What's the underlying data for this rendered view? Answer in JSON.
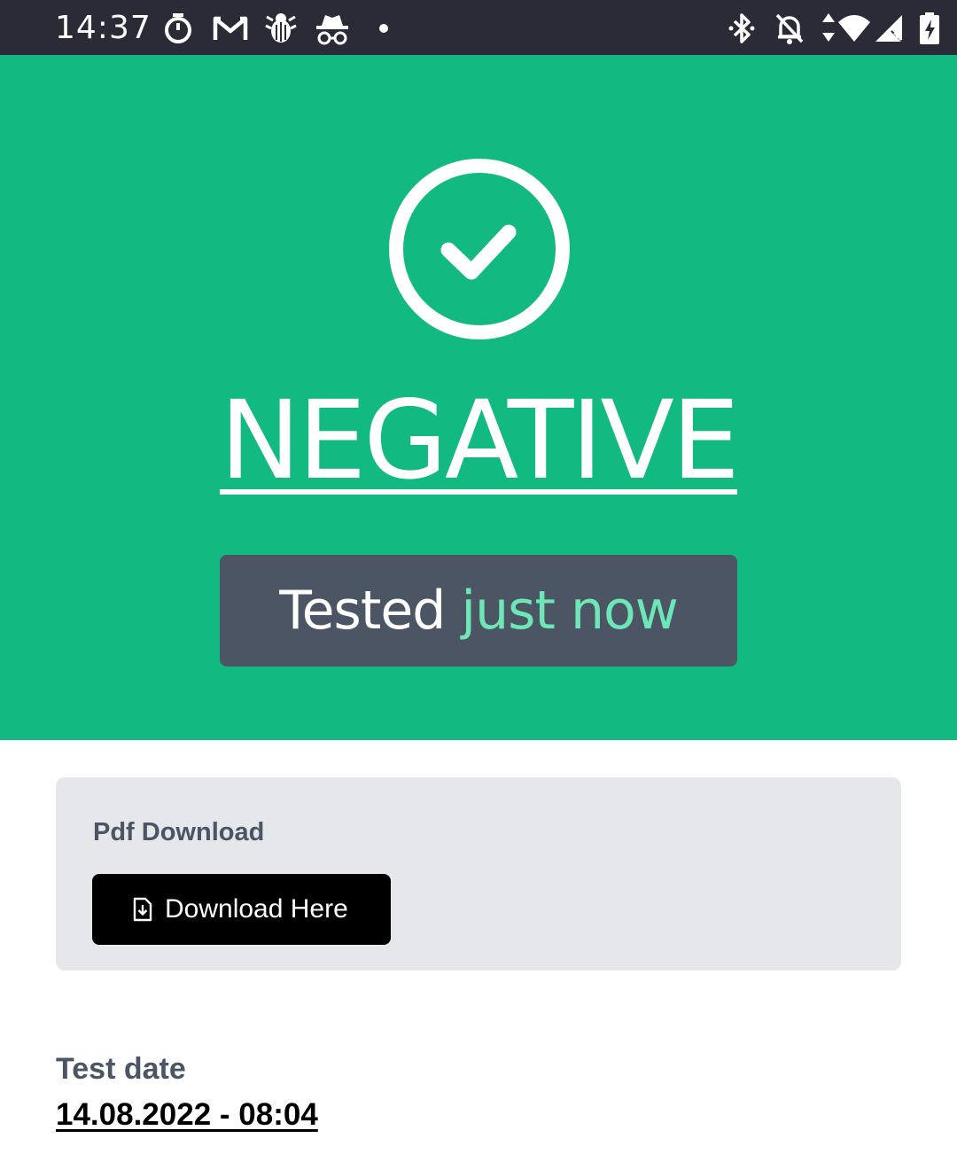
{
  "status_bar": {
    "time": "14:37",
    "left_icons": [
      "timer-icon",
      "gmail-icon",
      "bug-icon",
      "incognito-icon",
      "notification-dot-icon"
    ],
    "right_icons": [
      "bluetooth-icon",
      "notifications-off-icon",
      "data-arrows-icon",
      "wifi-icon",
      "cell-signal-icon",
      "battery-charging-icon"
    ]
  },
  "result": {
    "icon": "check-circle-icon",
    "title": "NEGATIVE",
    "tested_prefix": "Tested",
    "tested_when": "just now"
  },
  "pdf": {
    "label": "Pdf Download",
    "button_label": "Download Here",
    "button_icon": "file-download-icon"
  },
  "test_date": {
    "label": "Test date",
    "value": "14.08.2022 - 08:04"
  },
  "colors": {
    "hero_green": "#12b981",
    "accent_mint": "#6ee7b7",
    "slate": "#4b5563",
    "status_bar": "#2a2b36",
    "card_gray": "#e5e7eb"
  }
}
